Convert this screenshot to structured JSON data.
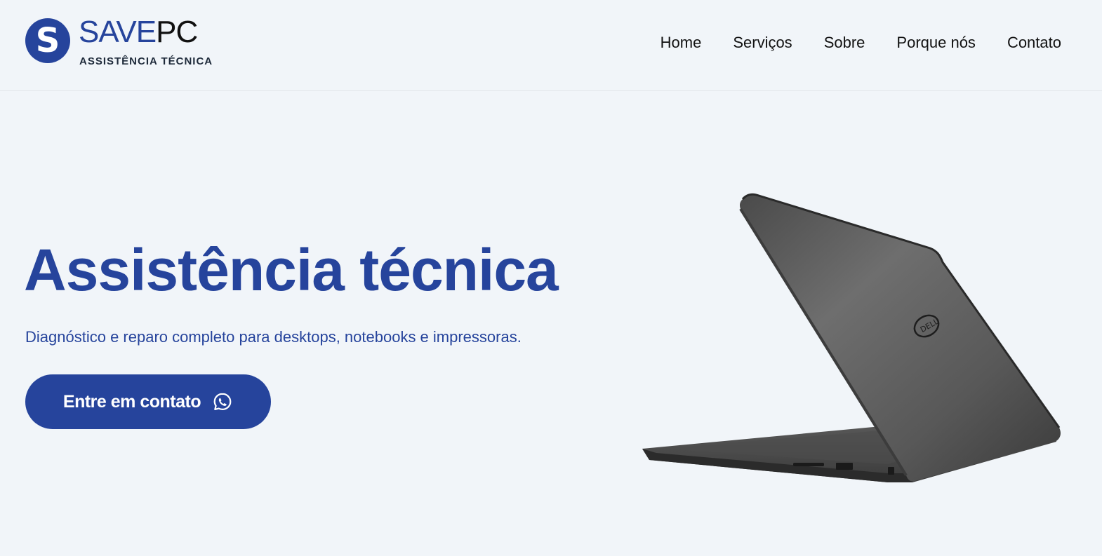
{
  "header": {
    "logo": {
      "letter": "S",
      "name_part1": "SAVE",
      "name_part2": "PC",
      "tagline": "ASSISTÊNCIA TÉCNICA"
    },
    "nav": [
      {
        "label": "Home"
      },
      {
        "label": "Serviços"
      },
      {
        "label": "Sobre"
      },
      {
        "label": "Porque nós"
      },
      {
        "label": "Contato"
      }
    ]
  },
  "hero": {
    "title": "Assistência técnica",
    "subtitle": "Diagnóstico e reparo completo para desktops, notebooks e impressoras.",
    "cta_label": "Entre em contato",
    "cta_icon": "whatsapp-icon",
    "image": "laptop"
  },
  "colors": {
    "brand": "#26449c",
    "background": "#f1f5f9",
    "nav_text": "#111111"
  }
}
